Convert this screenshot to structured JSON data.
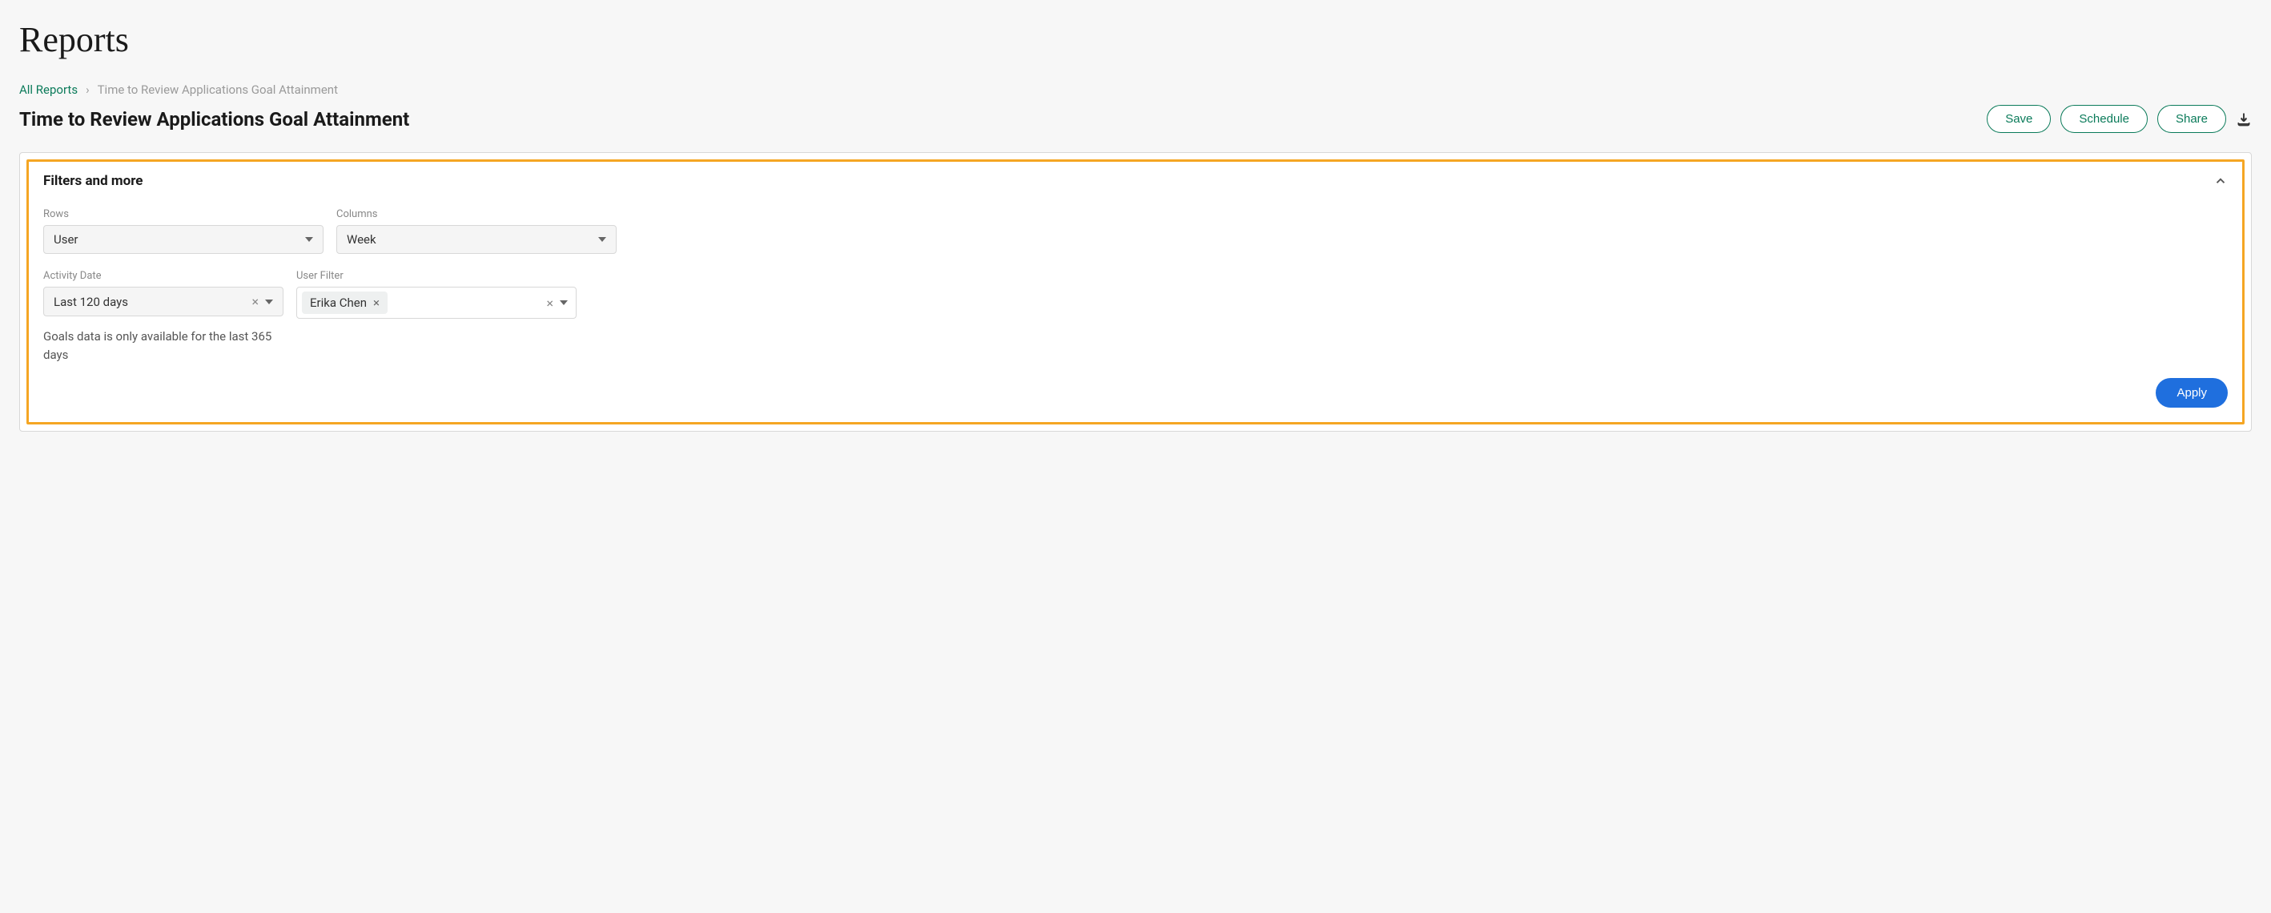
{
  "page": {
    "title": "Reports"
  },
  "breadcrumb": {
    "root": "All Reports",
    "separator": "›",
    "current": "Time to Review Applications Goal Attainment"
  },
  "report": {
    "title": "Time to Review Applications Goal Attainment"
  },
  "actions": {
    "save": "Save",
    "schedule": "Schedule",
    "share": "Share"
  },
  "panel": {
    "title": "Filters and more",
    "rows_label": "Rows",
    "rows_value": "User",
    "columns_label": "Columns",
    "columns_value": "Week",
    "activity_date_label": "Activity Date",
    "activity_date_value": "Last 120 days",
    "user_filter_label": "User Filter",
    "user_filter_chip": "Erika Chen",
    "help_text": "Goals data is only available for the last 365 days",
    "apply": "Apply"
  }
}
